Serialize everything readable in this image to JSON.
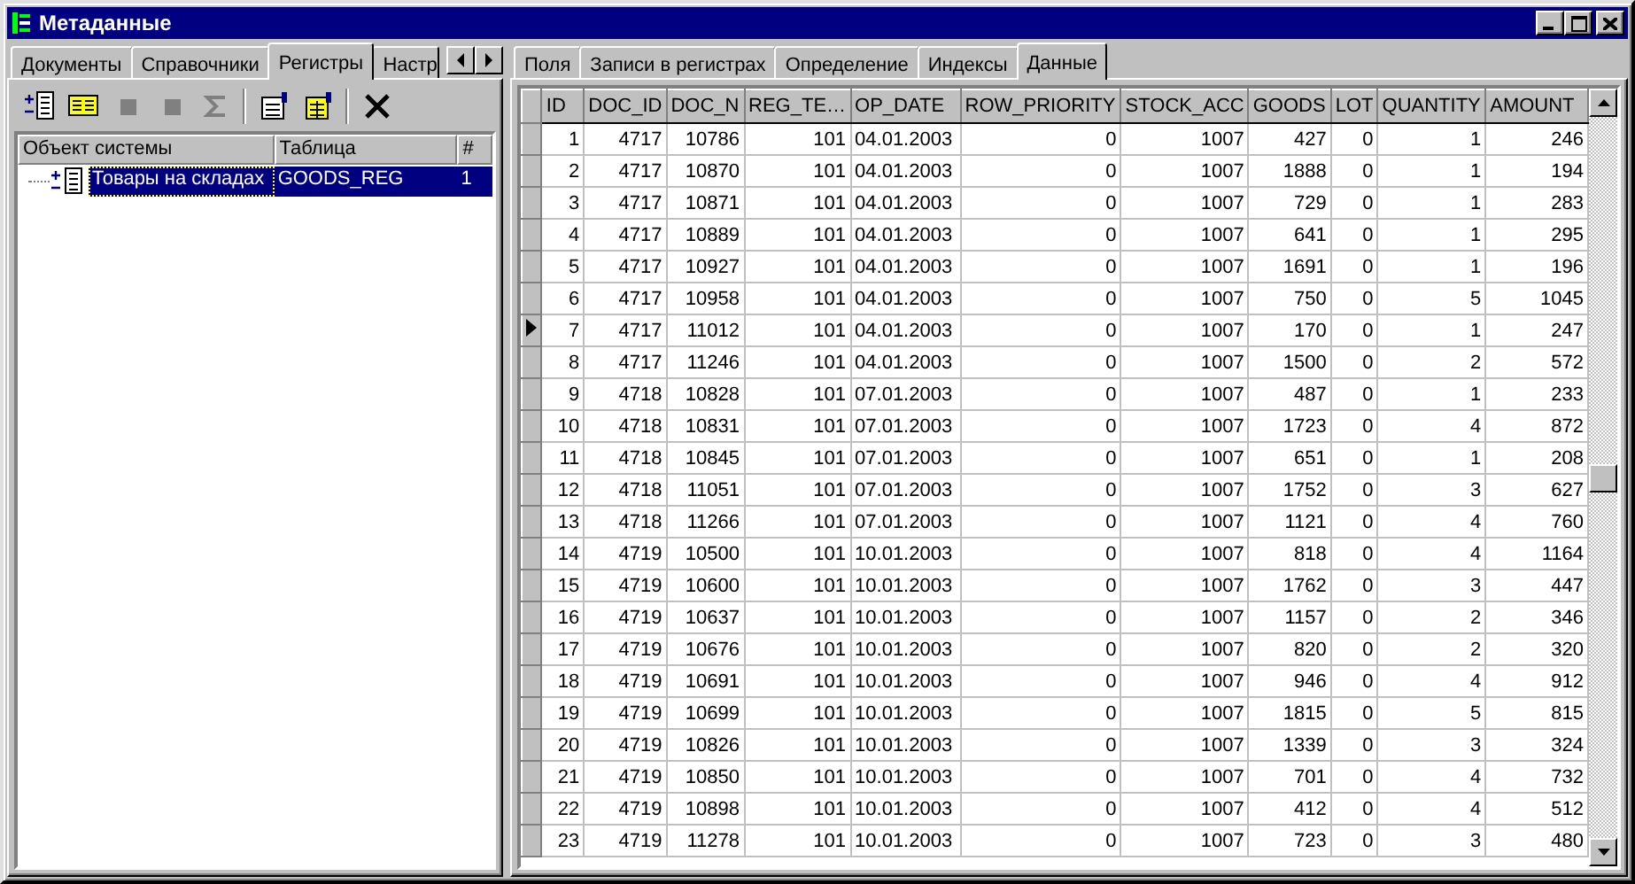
{
  "window": {
    "title": "Метаданные"
  },
  "left_tabs": [
    {
      "label": "Документы",
      "selected": false
    },
    {
      "label": "Справочники",
      "selected": false
    },
    {
      "label": "Регистры",
      "selected": true
    },
    {
      "label": "Настр",
      "selected": false
    }
  ],
  "toolbar": [
    {
      "kind": "add",
      "disabled": false
    },
    {
      "kind": "formula",
      "disabled": false
    },
    {
      "kind": "stop",
      "disabled": true
    },
    {
      "kind": "stop",
      "disabled": true
    },
    {
      "kind": "sum",
      "disabled": true
    },
    {
      "kind": "separator"
    },
    {
      "kind": "properties",
      "disabled": false
    },
    {
      "kind": "table-properties",
      "disabled": false
    },
    {
      "kind": "separator"
    },
    {
      "kind": "delete",
      "disabled": false
    }
  ],
  "tree": {
    "columns": [
      "Объект системы",
      "Таблица",
      "#"
    ],
    "rows": [
      {
        "cells": [
          "Товары на складах",
          "GOODS_REG",
          "1"
        ],
        "selected": true,
        "expanded": false
      }
    ]
  },
  "right_tabs": [
    {
      "label": "Поля",
      "selected": false
    },
    {
      "label": "Записи в регистрах",
      "selected": false
    },
    {
      "label": "Определение",
      "selected": false
    },
    {
      "label": "Индексы",
      "selected": false
    },
    {
      "label": "Данные",
      "selected": true
    }
  ],
  "grid": {
    "columns": [
      "ID",
      "DOC_ID",
      "DOC_N",
      "REG_TE…",
      "OP_DATE",
      "ROW_PRIORITY",
      "STOCK_ACC",
      "GOODS",
      "LOT",
      "QUANTITY",
      "AMOUNT"
    ],
    "rows": [
      {
        "current": false,
        "cells": [
          "1",
          "4717",
          "10786",
          "101",
          "04.01.2003",
          "0",
          "1007",
          "427",
          "0",
          "1",
          "246"
        ]
      },
      {
        "current": false,
        "cells": [
          "2",
          "4717",
          "10870",
          "101",
          "04.01.2003",
          "0",
          "1007",
          "1888",
          "0",
          "1",
          "194"
        ]
      },
      {
        "current": false,
        "cells": [
          "3",
          "4717",
          "10871",
          "101",
          "04.01.2003",
          "0",
          "1007",
          "729",
          "0",
          "1",
          "283"
        ]
      },
      {
        "current": false,
        "cells": [
          "4",
          "4717",
          "10889",
          "101",
          "04.01.2003",
          "0",
          "1007",
          "641",
          "0",
          "1",
          "295"
        ]
      },
      {
        "current": false,
        "cells": [
          "5",
          "4717",
          "10927",
          "101",
          "04.01.2003",
          "0",
          "1007",
          "1691",
          "0",
          "1",
          "196"
        ]
      },
      {
        "current": false,
        "cells": [
          "6",
          "4717",
          "10958",
          "101",
          "04.01.2003",
          "0",
          "1007",
          "750",
          "0",
          "5",
          "1045"
        ]
      },
      {
        "current": true,
        "cells": [
          "7",
          "4717",
          "11012",
          "101",
          "04.01.2003",
          "0",
          "1007",
          "170",
          "0",
          "1",
          "247"
        ]
      },
      {
        "current": false,
        "cells": [
          "8",
          "4717",
          "11246",
          "101",
          "04.01.2003",
          "0",
          "1007",
          "1500",
          "0",
          "2",
          "572"
        ]
      },
      {
        "current": false,
        "cells": [
          "9",
          "4718",
          "10828",
          "101",
          "07.01.2003",
          "0",
          "1007",
          "487",
          "0",
          "1",
          "233"
        ]
      },
      {
        "current": false,
        "cells": [
          "10",
          "4718",
          "10831",
          "101",
          "07.01.2003",
          "0",
          "1007",
          "1723",
          "0",
          "4",
          "872"
        ]
      },
      {
        "current": false,
        "cells": [
          "11",
          "4718",
          "10845",
          "101",
          "07.01.2003",
          "0",
          "1007",
          "651",
          "0",
          "1",
          "208"
        ]
      },
      {
        "current": false,
        "cells": [
          "12",
          "4718",
          "11051",
          "101",
          "07.01.2003",
          "0",
          "1007",
          "1752",
          "0",
          "3",
          "627"
        ]
      },
      {
        "current": false,
        "cells": [
          "13",
          "4718",
          "11266",
          "101",
          "07.01.2003",
          "0",
          "1007",
          "1121",
          "0",
          "4",
          "760"
        ]
      },
      {
        "current": false,
        "cells": [
          "14",
          "4719",
          "10500",
          "101",
          "10.01.2003",
          "0",
          "1007",
          "818",
          "0",
          "4",
          "1164"
        ]
      },
      {
        "current": false,
        "cells": [
          "15",
          "4719",
          "10600",
          "101",
          "10.01.2003",
          "0",
          "1007",
          "1762",
          "0",
          "3",
          "447"
        ]
      },
      {
        "current": false,
        "cells": [
          "16",
          "4719",
          "10637",
          "101",
          "10.01.2003",
          "0",
          "1007",
          "1157",
          "0",
          "2",
          "346"
        ]
      },
      {
        "current": false,
        "cells": [
          "17",
          "4719",
          "10676",
          "101",
          "10.01.2003",
          "0",
          "1007",
          "820",
          "0",
          "2",
          "320"
        ]
      },
      {
        "current": false,
        "cells": [
          "18",
          "4719",
          "10691",
          "101",
          "10.01.2003",
          "0",
          "1007",
          "946",
          "0",
          "4",
          "912"
        ]
      },
      {
        "current": false,
        "cells": [
          "19",
          "4719",
          "10699",
          "101",
          "10.01.2003",
          "0",
          "1007",
          "1815",
          "0",
          "5",
          "815"
        ]
      },
      {
        "current": false,
        "cells": [
          "20",
          "4719",
          "10826",
          "101",
          "10.01.2003",
          "0",
          "1007",
          "1339",
          "0",
          "3",
          "324"
        ]
      },
      {
        "current": false,
        "cells": [
          "21",
          "4719",
          "10850",
          "101",
          "10.01.2003",
          "0",
          "1007",
          "701",
          "0",
          "4",
          "732"
        ]
      },
      {
        "current": false,
        "cells": [
          "22",
          "4719",
          "10898",
          "101",
          "10.01.2003",
          "0",
          "1007",
          "412",
          "0",
          "4",
          "512"
        ]
      },
      {
        "current": false,
        "cells": [
          "23",
          "4719",
          "11278",
          "101",
          "10.01.2003",
          "0",
          "1007",
          "723",
          "0",
          "3",
          "480"
        ]
      }
    ]
  }
}
